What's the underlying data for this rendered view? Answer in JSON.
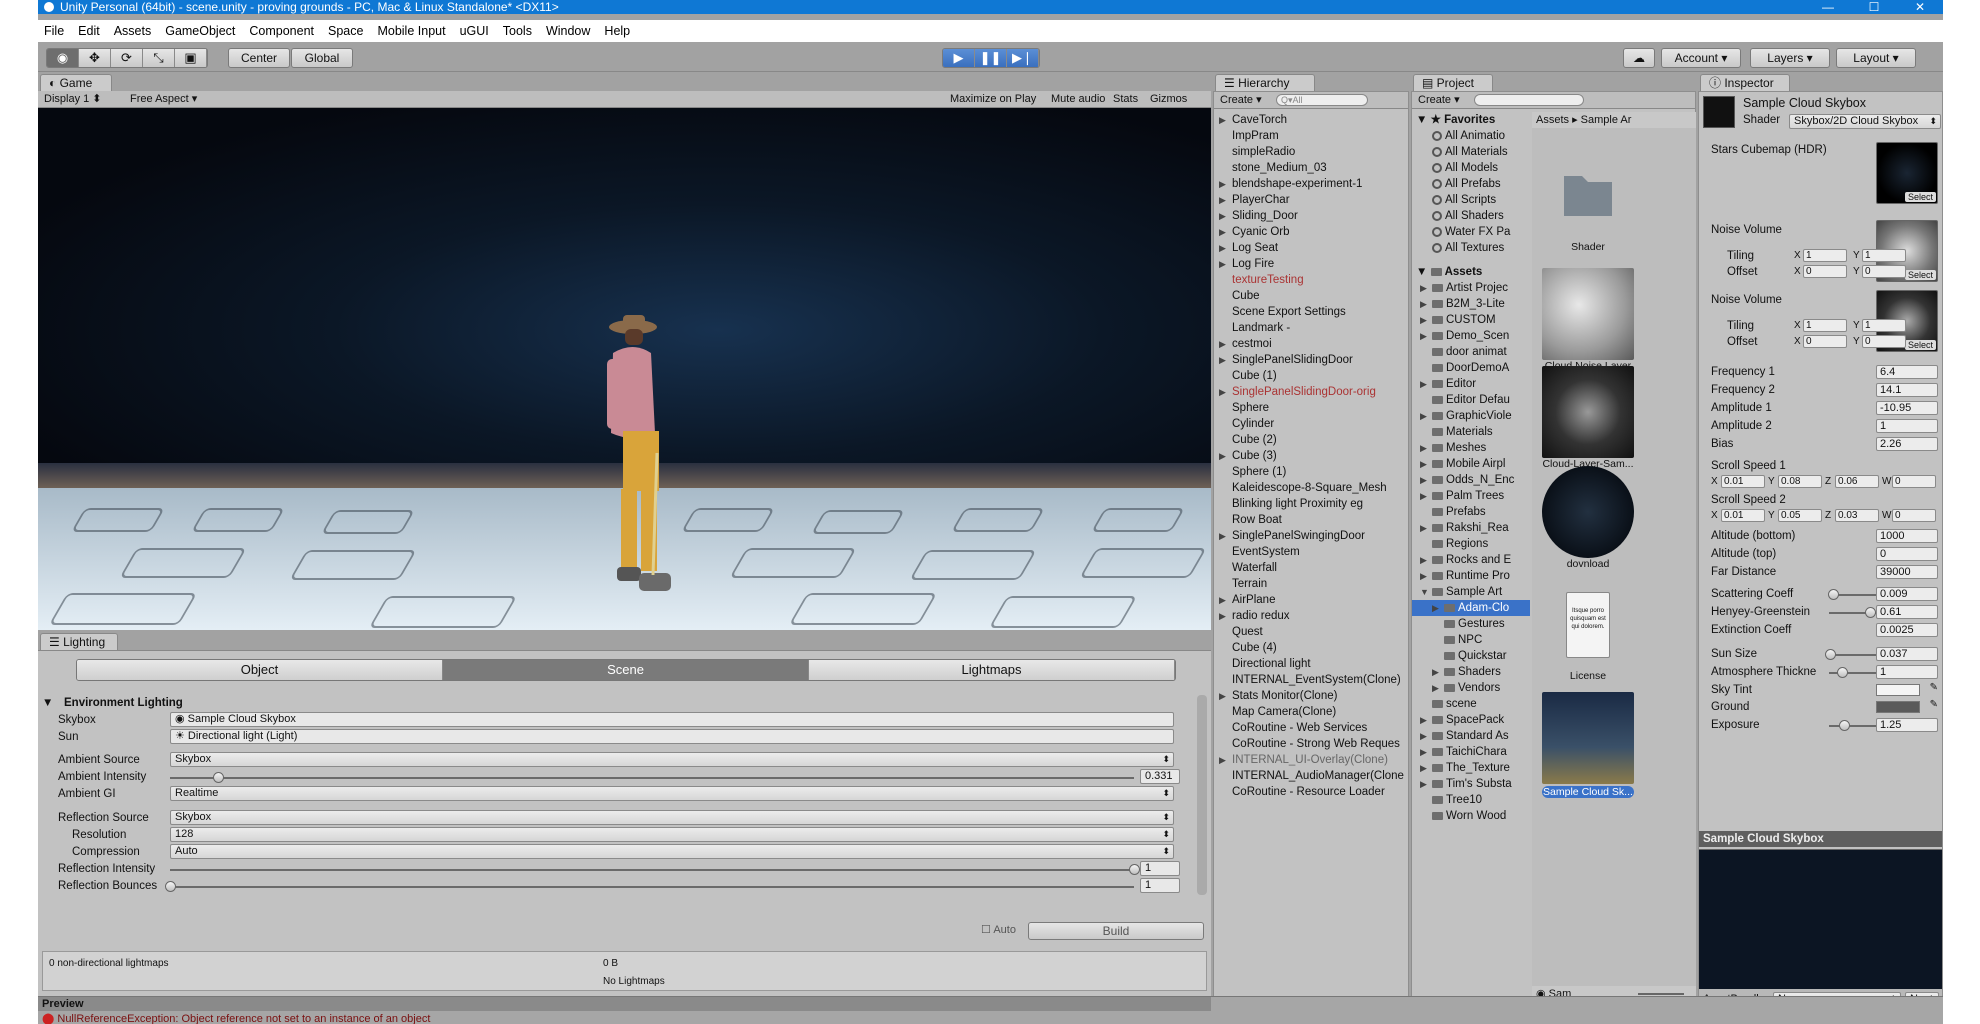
{
  "window": {
    "title": "Unity Personal (64bit) - scene.unity - proving grounds - PC, Mac & Linux Standalone* <DX11>",
    "controls": [
      "—",
      "☐",
      "✕"
    ]
  },
  "menu": [
    "File",
    "Edit",
    "Assets",
    "GameObject",
    "Component",
    "Space",
    "Mobile Input",
    "uGUI",
    "Tools",
    "Window",
    "Help"
  ],
  "toolbar": {
    "tools": [
      "◉",
      "✥",
      "⟳",
      "⤡",
      "▣"
    ],
    "pivot": "Center",
    "space": "Global",
    "play": [
      "▶",
      "❚❚",
      "▶❘"
    ],
    "account": "Account",
    "layers": "Layers",
    "layout": "Layout"
  },
  "game": {
    "tab": "Game",
    "display": "Display 1",
    "aspect": "Free Aspect",
    "options": [
      "Maximize on Play",
      "Mute audio",
      "Stats",
      "Gizmos"
    ]
  },
  "lighting": {
    "tab": "Lighting",
    "modes": [
      "Object",
      "Scene",
      "Lightmaps"
    ],
    "section": "Environment Lighting",
    "rows": {
      "skybox_label": "Skybox",
      "skybox_value": "Sample Cloud Skybox",
      "sun_label": "Sun",
      "sun_value": "Directional light (Light)",
      "ambient_source_label": "Ambient Source",
      "ambient_source_value": "Skybox",
      "ambient_intensity_label": "Ambient Intensity",
      "ambient_intensity_value": "0.331",
      "ambient_gi_label": "Ambient GI",
      "ambient_gi_value": "Realtime",
      "reflection_source_label": "Reflection Source",
      "reflection_source_value": "Skybox",
      "resolution_label": "Resolution",
      "resolution_value": "128",
      "compression_label": "Compression",
      "compression_value": "Auto",
      "reflection_intensity_label": "Reflection Intensity",
      "reflection_intensity_value": "1",
      "reflection_bounces_label": "Reflection Bounces",
      "reflection_bounces_value": "1"
    },
    "auto_label": "Auto",
    "build_label": "Build",
    "lightmap_info": "0 non-directional lightmaps",
    "size": "0 B",
    "no_lightmaps": "No Lightmaps",
    "ambient_intensity_fraction": 0.05,
    "reflection_intensity_fraction": 1.0,
    "reflection_bounces_fraction": 0.0
  },
  "preview_label": "Preview",
  "error_text": "NullReferenceException: Object reference not set to an instance of an object",
  "hierarchy": {
    "tab": "Hierarchy",
    "create": "Create",
    "search_placeholder": "Q▾All",
    "items": [
      {
        "label": "CaveTorch",
        "arrow": true,
        "style": ""
      },
      {
        "label": "ImpPram",
        "arrow": false,
        "style": ""
      },
      {
        "label": "simpleRadio",
        "arrow": false,
        "style": ""
      },
      {
        "label": "stone_Medium_03",
        "arrow": false,
        "style": ""
      },
      {
        "label": "blendshape-experiment-1",
        "arrow": true,
        "style": ""
      },
      {
        "label": "PlayerChar",
        "arrow": true,
        "style": ""
      },
      {
        "label": "Sliding_Door",
        "arrow": true,
        "style": ""
      },
      {
        "label": "Cyanic Orb",
        "arrow": true,
        "style": ""
      },
      {
        "label": "Log Seat",
        "arrow": true,
        "style": ""
      },
      {
        "label": "Log Fire",
        "arrow": true,
        "style": ""
      },
      {
        "label": "textureTesting",
        "arrow": false,
        "style": "red"
      },
      {
        "label": "Cube",
        "arrow": false,
        "style": ""
      },
      {
        "label": "Scene Export Settings",
        "arrow": false,
        "style": ""
      },
      {
        "label": "Landmark -",
        "arrow": false,
        "style": ""
      },
      {
        "label": "cestmoi",
        "arrow": true,
        "style": ""
      },
      {
        "label": "SinglePanelSlidingDoor",
        "arrow": true,
        "style": ""
      },
      {
        "label": "Cube (1)",
        "arrow": false,
        "style": ""
      },
      {
        "label": "SinglePanelSlidingDoor-orig",
        "arrow": true,
        "style": "red"
      },
      {
        "label": "Sphere",
        "arrow": false,
        "style": ""
      },
      {
        "label": "Cylinder",
        "arrow": false,
        "style": ""
      },
      {
        "label": "Cube (2)",
        "arrow": false,
        "style": ""
      },
      {
        "label": "Cube (3)",
        "arrow": true,
        "style": ""
      },
      {
        "label": "Sphere (1)",
        "arrow": false,
        "style": ""
      },
      {
        "label": "Kaleidescope-8-Square_Mesh",
        "arrow": false,
        "style": ""
      },
      {
        "label": "Blinking light Proximity eg",
        "arrow": false,
        "style": ""
      },
      {
        "label": "Row Boat",
        "arrow": false,
        "style": ""
      },
      {
        "label": "SinglePanelSwingingDoor",
        "arrow": true,
        "style": ""
      },
      {
        "label": "EventSystem",
        "arrow": false,
        "style": ""
      },
      {
        "label": "Waterfall",
        "arrow": false,
        "style": ""
      },
      {
        "label": "Terrain",
        "arrow": false,
        "style": ""
      },
      {
        "label": "AirPlane",
        "arrow": true,
        "style": ""
      },
      {
        "label": "radio redux",
        "arrow": true,
        "style": ""
      },
      {
        "label": "Quest",
        "arrow": false,
        "style": ""
      },
      {
        "label": "Cube (4)",
        "arrow": false,
        "style": ""
      },
      {
        "label": "Directional light",
        "arrow": false,
        "style": ""
      },
      {
        "label": "INTERNAL_EventSystem(Clone)",
        "arrow": false,
        "style": ""
      },
      {
        "label": "Stats Monitor(Clone)",
        "arrow": true,
        "style": ""
      },
      {
        "label": "Map Camera(Clone)",
        "arrow": false,
        "style": ""
      },
      {
        "label": "CoRoutine - Web Services",
        "arrow": false,
        "style": ""
      },
      {
        "label": "CoRoutine - Strong Web Reques",
        "arrow": false,
        "style": ""
      },
      {
        "label": "INTERNAL_UI-Overlay(Clone)",
        "arrow": true,
        "style": "dim"
      },
      {
        "label": "INTERNAL_AudioManager(Clone",
        "arrow": false,
        "style": ""
      },
      {
        "label": "CoRoutine - Resource Loader",
        "arrow": false,
        "style": ""
      }
    ]
  },
  "project": {
    "tab": "Project",
    "create": "Create",
    "favorites_label": "Favorites",
    "favorites": [
      "All Animatio",
      "All Materials",
      "All Models",
      "All Prefabs",
      "All Scripts",
      "All Shaders",
      "Water FX Pa",
      "All Textures"
    ],
    "assets_label": "Assets",
    "folders": [
      {
        "label": "Artist Projec",
        "arrow": true,
        "indent": 0
      },
      {
        "label": "B2M_3-Lite",
        "arrow": true,
        "indent": 0
      },
      {
        "label": "CUSTOM",
        "arrow": true,
        "indent": 0
      },
      {
        "label": "Demo_Scen",
        "arrow": true,
        "indent": 0
      },
      {
        "label": "door animat",
        "arrow": false,
        "indent": 0
      },
      {
        "label": "DoorDemoA",
        "arrow": false,
        "indent": 0
      },
      {
        "label": "Editor",
        "arrow": true,
        "indent": 0
      },
      {
        "label": "Editor Defau",
        "arrow": false,
        "indent": 0
      },
      {
        "label": "GraphicViole",
        "arrow": true,
        "indent": 0
      },
      {
        "label": "Materials",
        "arrow": false,
        "indent": 0
      },
      {
        "label": "Meshes",
        "arrow": true,
        "indent": 0
      },
      {
        "label": "Mobile Airpl",
        "arrow": true,
        "indent": 0
      },
      {
        "label": "Odds_N_Enc",
        "arrow": true,
        "indent": 0
      },
      {
        "label": "Palm Trees",
        "arrow": true,
        "indent": 0
      },
      {
        "label": "Prefabs",
        "arrow": false,
        "indent": 0
      },
      {
        "label": "Rakshi_Rea",
        "arrow": true,
        "indent": 0
      },
      {
        "label": "Regions",
        "arrow": false,
        "indent": 0
      },
      {
        "label": "Rocks and E",
        "arrow": true,
        "indent": 0
      },
      {
        "label": "Runtime Pro",
        "arrow": true,
        "indent": 0
      },
      {
        "label": "Sample Art",
        "arrow": true,
        "indent": 0
      },
      {
        "label": "Adam-Clo",
        "arrow": true,
        "indent": 1
      },
      {
        "label": "Gestures",
        "arrow": false,
        "indent": 1
      },
      {
        "label": "NPC",
        "arrow": false,
        "indent": 1
      },
      {
        "label": "Quickstar",
        "arrow": false,
        "indent": 1
      },
      {
        "label": "Shaders",
        "arrow": true,
        "indent": 1
      },
      {
        "label": "Vendors",
        "arrow": true,
        "indent": 1
      },
      {
        "label": "scene",
        "arrow": false,
        "indent": 0
      },
      {
        "label": "SpacePack",
        "arrow": true,
        "indent": 0
      },
      {
        "label": "Standard As",
        "arrow": true,
        "indent": 0
      },
      {
        "label": "TaichiChara",
        "arrow": true,
        "indent": 0
      },
      {
        "label": "The_Texture",
        "arrow": true,
        "indent": 0
      },
      {
        "label": "Tim's Substa",
        "arrow": true,
        "indent": 0
      },
      {
        "label": "Tree10",
        "arrow": false,
        "indent": 0
      },
      {
        "label": "Worn Wood",
        "arrow": false,
        "indent": 0
      }
    ],
    "breadcrumb": [
      "Assets",
      "Sample Ar"
    ],
    "assets": [
      {
        "label": "Shader"
      },
      {
        "label": "Cloud Noise Layer"
      },
      {
        "label": "Cloud-Layer-Sam..."
      },
      {
        "label": "dovnload"
      },
      {
        "label": "License"
      },
      {
        "label": "Sample Cloud Sk..."
      }
    ],
    "license_text": "Itsque porro quisquam est qui dolorem.",
    "search_bottom": "Sam"
  },
  "inspector": {
    "tab": "Inspector",
    "material_name": "Sample Cloud Skybox",
    "shader_label": "Shader",
    "shader_value": "Skybox/2D Cloud Skybox",
    "stars_label": "Stars Cubemap (HDR)",
    "noise1_label": "Noise Volume",
    "noise2_label": "Noise Volume",
    "tiling_label": "Tiling",
    "offset_label": "Offset",
    "select_label": "Select",
    "noise1": {
      "tx": "1",
      "ty": "1",
      "ox": "0",
      "oy": "0"
    },
    "noise2": {
      "tx": "1",
      "ty": "1",
      "ox": "0",
      "oy": "0"
    },
    "props": {
      "freq1_label": "Frequency 1",
      "freq1": "6.4",
      "freq2_label": "Frequency 2",
      "freq2": "14.1",
      "amp1_label": "Amplitude 1",
      "amp1": "-10.95",
      "amp2_label": "Amplitude 2",
      "amp2": "1",
      "bias_label": "Bias",
      "bias": "2.26",
      "scroll1_label": "Scroll Speed 1",
      "scroll2_label": "Scroll Speed 2",
      "alt_bottom_label": "Altitude (bottom)",
      "alt_bottom": "1000",
      "alt_top_label": "Altitude (top)",
      "alt_top": "0",
      "far_label": "Far Distance",
      "far": "39000",
      "scatter_label": "Scattering Coeff",
      "scatter": "0.009",
      "henyey_label": "Henyey-Greenstein",
      "henyey": "0.61",
      "extinct_label": "Extinction Coeff",
      "extinct": "0.0025",
      "sunsize_label": "Sun Size",
      "sunsize": "0.037",
      "atmos_label": "Atmosphere Thickne",
      "atmos": "1",
      "skytint_label": "Sky Tint",
      "ground_label": "Ground",
      "exposure_label": "Exposure",
      "exposure": "1.25"
    },
    "scroll1": {
      "x": "0.01",
      "y": "0.08",
      "z": "0.06",
      "w": "0"
    },
    "scroll2": {
      "x": "0.01",
      "y": "0.05",
      "z": "0.03",
      "w": "0"
    },
    "axis": {
      "x": "X",
      "y": "Y",
      "z": "Z",
      "w": "W"
    },
    "scatter_fraction": 0.05,
    "henyey_fraction": 0.55,
    "sunsize_fraction": 0.02,
    "atmos_fraction": 0.17,
    "exposure_fraction": 0.2,
    "preview_title": "Sample Cloud Skybox",
    "assetbundle_label": "AssetBundle",
    "assetbundle_value": "None",
    "assetbundle_variant": "None"
  },
  "colors": {
    "accent": "#0f78d4",
    "panel": "#c2c2c2",
    "error": "#cc2222"
  }
}
